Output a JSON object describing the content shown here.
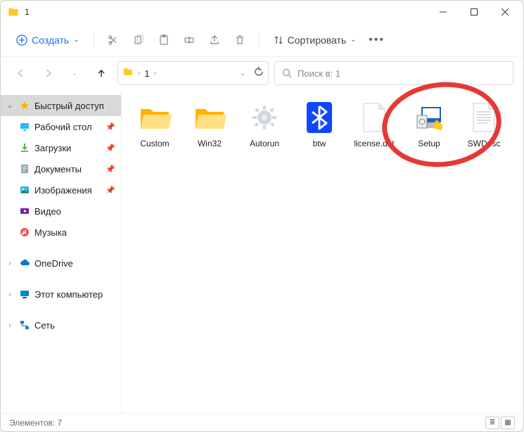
{
  "window": {
    "title": "1"
  },
  "toolbar": {
    "new_label": "Создать",
    "sort_label": "Сортировать"
  },
  "address": {
    "folder_name": "1"
  },
  "search": {
    "placeholder": "Поиск в: 1"
  },
  "sidebar": {
    "quick_access": "Быстрый доступ",
    "desktop": "Рабочий стол",
    "downloads": "Загрузки",
    "documents": "Документы",
    "pictures": "Изображения",
    "videos": "Видео",
    "music": "Музыка",
    "onedrive": "OneDrive",
    "this_pc": "Этот компьютер",
    "network": "Сеть"
  },
  "items": {
    "i0": "Custom",
    "i1": "Win32",
    "i2": "Autorun",
    "i3": "btw",
    "i4": "license.dat",
    "i5": "Setup",
    "i6": "SWDesc"
  },
  "status": {
    "count_label": "Элементов: 7"
  }
}
